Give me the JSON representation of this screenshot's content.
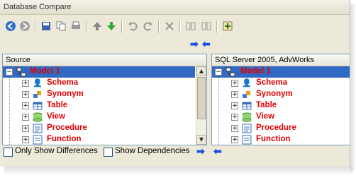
{
  "window": {
    "title": "Database Compare"
  },
  "toolbar": {
    "buttons": [
      "back-icon",
      "forward-icon",
      "save-icon",
      "copy-icon",
      "print-icon",
      "up-icon",
      "down-icon",
      "undo-icon",
      "redo-icon",
      "delete-icon",
      "columns-icon",
      "rows-icon",
      "add-icon"
    ]
  },
  "left_pane": {
    "header": "Source",
    "root": "Model 1",
    "items": [
      "Schema",
      "Synonym",
      "Table",
      "View",
      "Procedure",
      "Function"
    ]
  },
  "right_pane": {
    "header": "SQL Server 2005, AdvWorks",
    "root": "Model 1",
    "items": [
      "Schema",
      "Synonym",
      "Table",
      "View",
      "Procedure",
      "Function"
    ]
  },
  "options": {
    "only_show_differences": "Only Show Differences",
    "show_dependencies": "Show Dependencies"
  },
  "colors": {
    "item_text": "#e00000",
    "selection": "#316ac5",
    "arrow": "#1a4fe0"
  }
}
